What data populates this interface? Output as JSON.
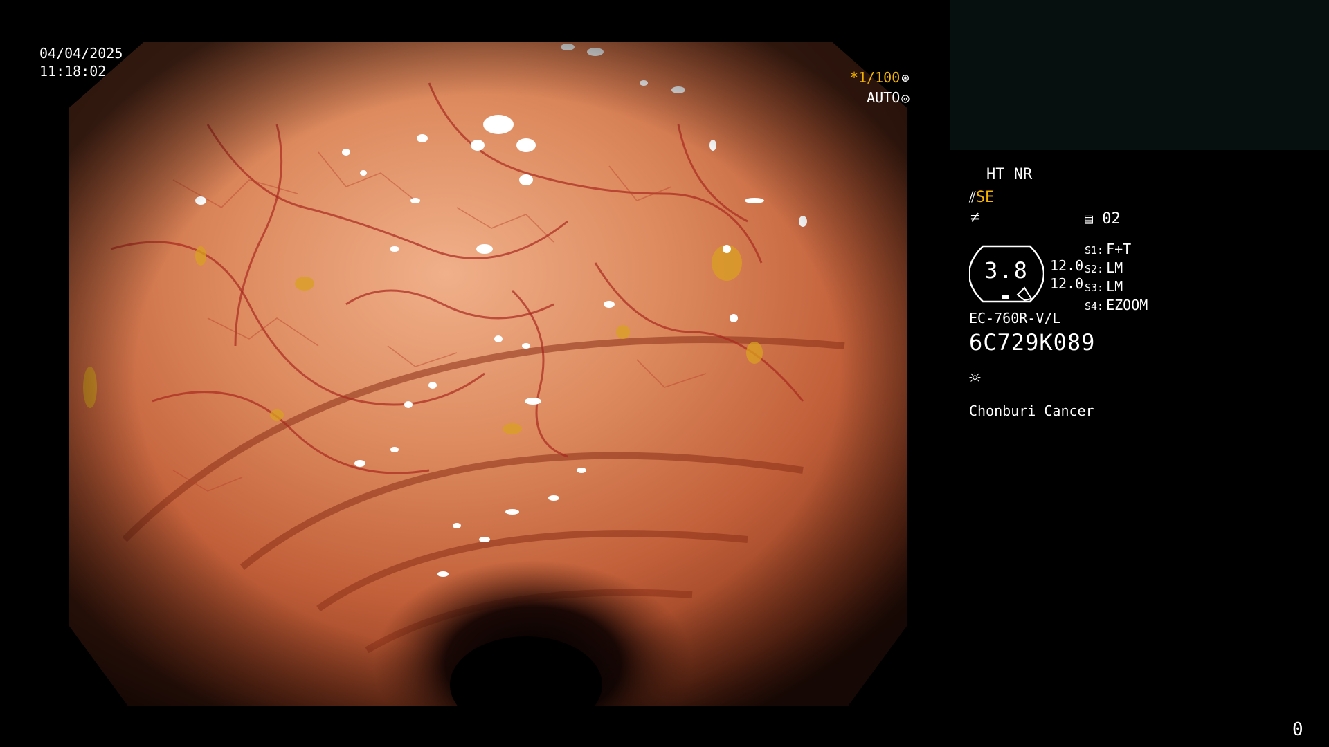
{
  "overlay": {
    "date": "04/04/2025",
    "time": "11:18:02",
    "shutter_speed": "*1/100",
    "shutter_icon": "shutter-icon",
    "auto_label": "AUTO",
    "auto_icon": "iris-icon"
  },
  "panel": {
    "mode_ht": "HT NR",
    "se_icon": "scope-icon",
    "se_label": "SE",
    "f_icon": "f-curve-icon",
    "memory_icon": "memory-card-icon",
    "memory_value": "02",
    "gauge_value": "3.8",
    "level_top": "12.0",
    "level_bottom": "12.0",
    "switches": [
      {
        "label": "S1:",
        "value": "F+T"
      },
      {
        "label": "S2:",
        "value": "LM"
      },
      {
        "label": "S3:",
        "value": "LM"
      },
      {
        "label": "S4:",
        "value": "EZOOM"
      }
    ],
    "scope_model": "EC-760R-V/L",
    "serial": "6C729K089",
    "light_icon": "light-source-icon",
    "institution": "Chonburi Cancer"
  },
  "corner_counter": "0",
  "colors": {
    "background": "#000000",
    "accent_yellow": "#f5b400",
    "tissue_base": "#c2603a",
    "vessel": "#a8281e"
  }
}
